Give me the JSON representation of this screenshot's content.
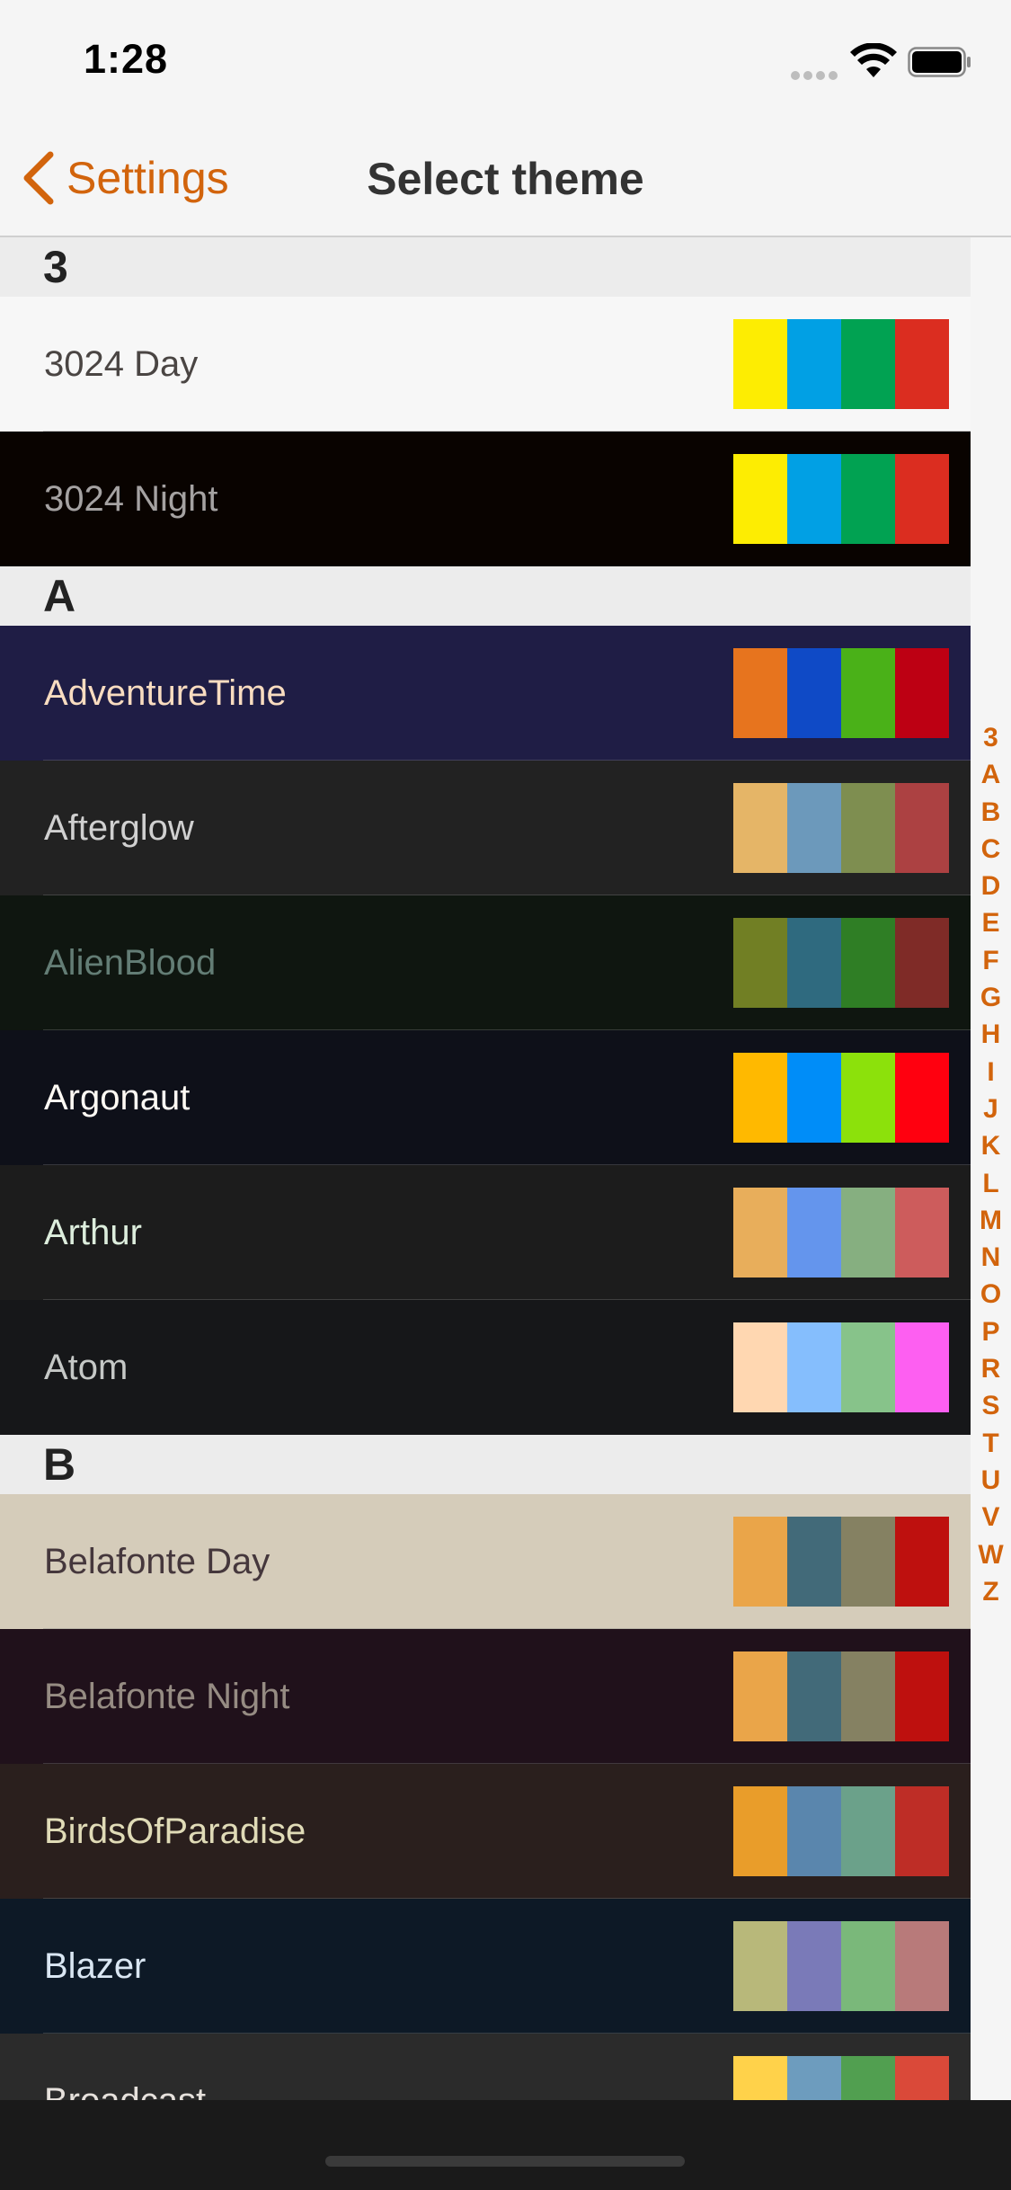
{
  "status_bar": {
    "time": "1:28"
  },
  "nav": {
    "back_label": "Settings",
    "title": "Select theme",
    "accent_color": "#d2640c"
  },
  "sections": [
    {
      "header": "3",
      "themes": [
        {
          "name": "3024 Day",
          "bg": "#f7f7f7",
          "fg": "#4a4543",
          "colors": [
            "#fded02",
            "#01a0e4",
            "#01a252",
            "#db2d20"
          ]
        },
        {
          "name": "3024 Night",
          "bg": "#090300",
          "fg": "#a5a2a2",
          "colors": [
            "#fded02",
            "#01a0e4",
            "#01a252",
            "#db2d20"
          ]
        }
      ]
    },
    {
      "header": "A",
      "themes": [
        {
          "name": "AdventureTime",
          "bg": "#1f1d45",
          "fg": "#f8dcc0",
          "colors": [
            "#e7741e",
            "#0f4ac6",
            "#4ab118",
            "#bd0013"
          ]
        },
        {
          "name": "Afterglow",
          "bg": "#222222",
          "fg": "#d0d0d0",
          "colors": [
            "#e5b567",
            "#6c99bb",
            "#7e8e50",
            "#ac4142"
          ]
        },
        {
          "name": "AlienBlood",
          "bg": "#0f1610",
          "fg": "#637d75",
          "colors": [
            "#717f24",
            "#2f6a7f",
            "#2f7e25",
            "#7f2b27"
          ]
        },
        {
          "name": "Argonaut",
          "bg": "#0e1019",
          "fg": "#fffaf4",
          "colors": [
            "#ffb900",
            "#008df8",
            "#8ce10b",
            "#ff000f"
          ]
        },
        {
          "name": "Arthur",
          "bg": "#1c1c1c",
          "fg": "#ddeedd",
          "colors": [
            "#e8ae5b",
            "#6495ed",
            "#86af80",
            "#cd5c5c"
          ]
        },
        {
          "name": "Atom",
          "bg": "#161719",
          "fg": "#c5c8c6",
          "colors": [
            "#ffd7b1",
            "#85befd",
            "#87c38a",
            "#fd5ff1"
          ]
        }
      ]
    },
    {
      "header": "B",
      "themes": [
        {
          "name": "Belafonte Day",
          "bg": "#d5ccba",
          "fg": "#45373c",
          "colors": [
            "#eaa549",
            "#426a79",
            "#858162",
            "#be100e"
          ]
        },
        {
          "name": "Belafonte Night",
          "bg": "#20111b",
          "fg": "#968c83",
          "colors": [
            "#eaa549",
            "#426a79",
            "#858162",
            "#be100e"
          ]
        },
        {
          "name": "BirdsOfParadise",
          "bg": "#2a1f1d",
          "fg": "#e0dbb7",
          "colors": [
            "#e99d2a",
            "#5a86ad",
            "#6ba18a",
            "#be2d26"
          ]
        },
        {
          "name": "Blazer",
          "bg": "#0d1926",
          "fg": "#d9e6f2",
          "colors": [
            "#b8b87a",
            "#7a7ab8",
            "#7ab87a",
            "#b87a7a"
          ]
        },
        {
          "name": "Broadcast",
          "bg": "#2b2b2b",
          "fg": "#e6e1dc",
          "colors": [
            "#ffd24a",
            "#6d9cbe",
            "#519f50",
            "#da4939"
          ]
        }
      ]
    }
  ],
  "index_letters": [
    "3",
    "A",
    "B",
    "C",
    "D",
    "E",
    "F",
    "G",
    "H",
    "I",
    "J",
    "K",
    "L",
    "M",
    "N",
    "O",
    "P",
    "R",
    "S",
    "T",
    "U",
    "V",
    "W",
    "Z"
  ]
}
